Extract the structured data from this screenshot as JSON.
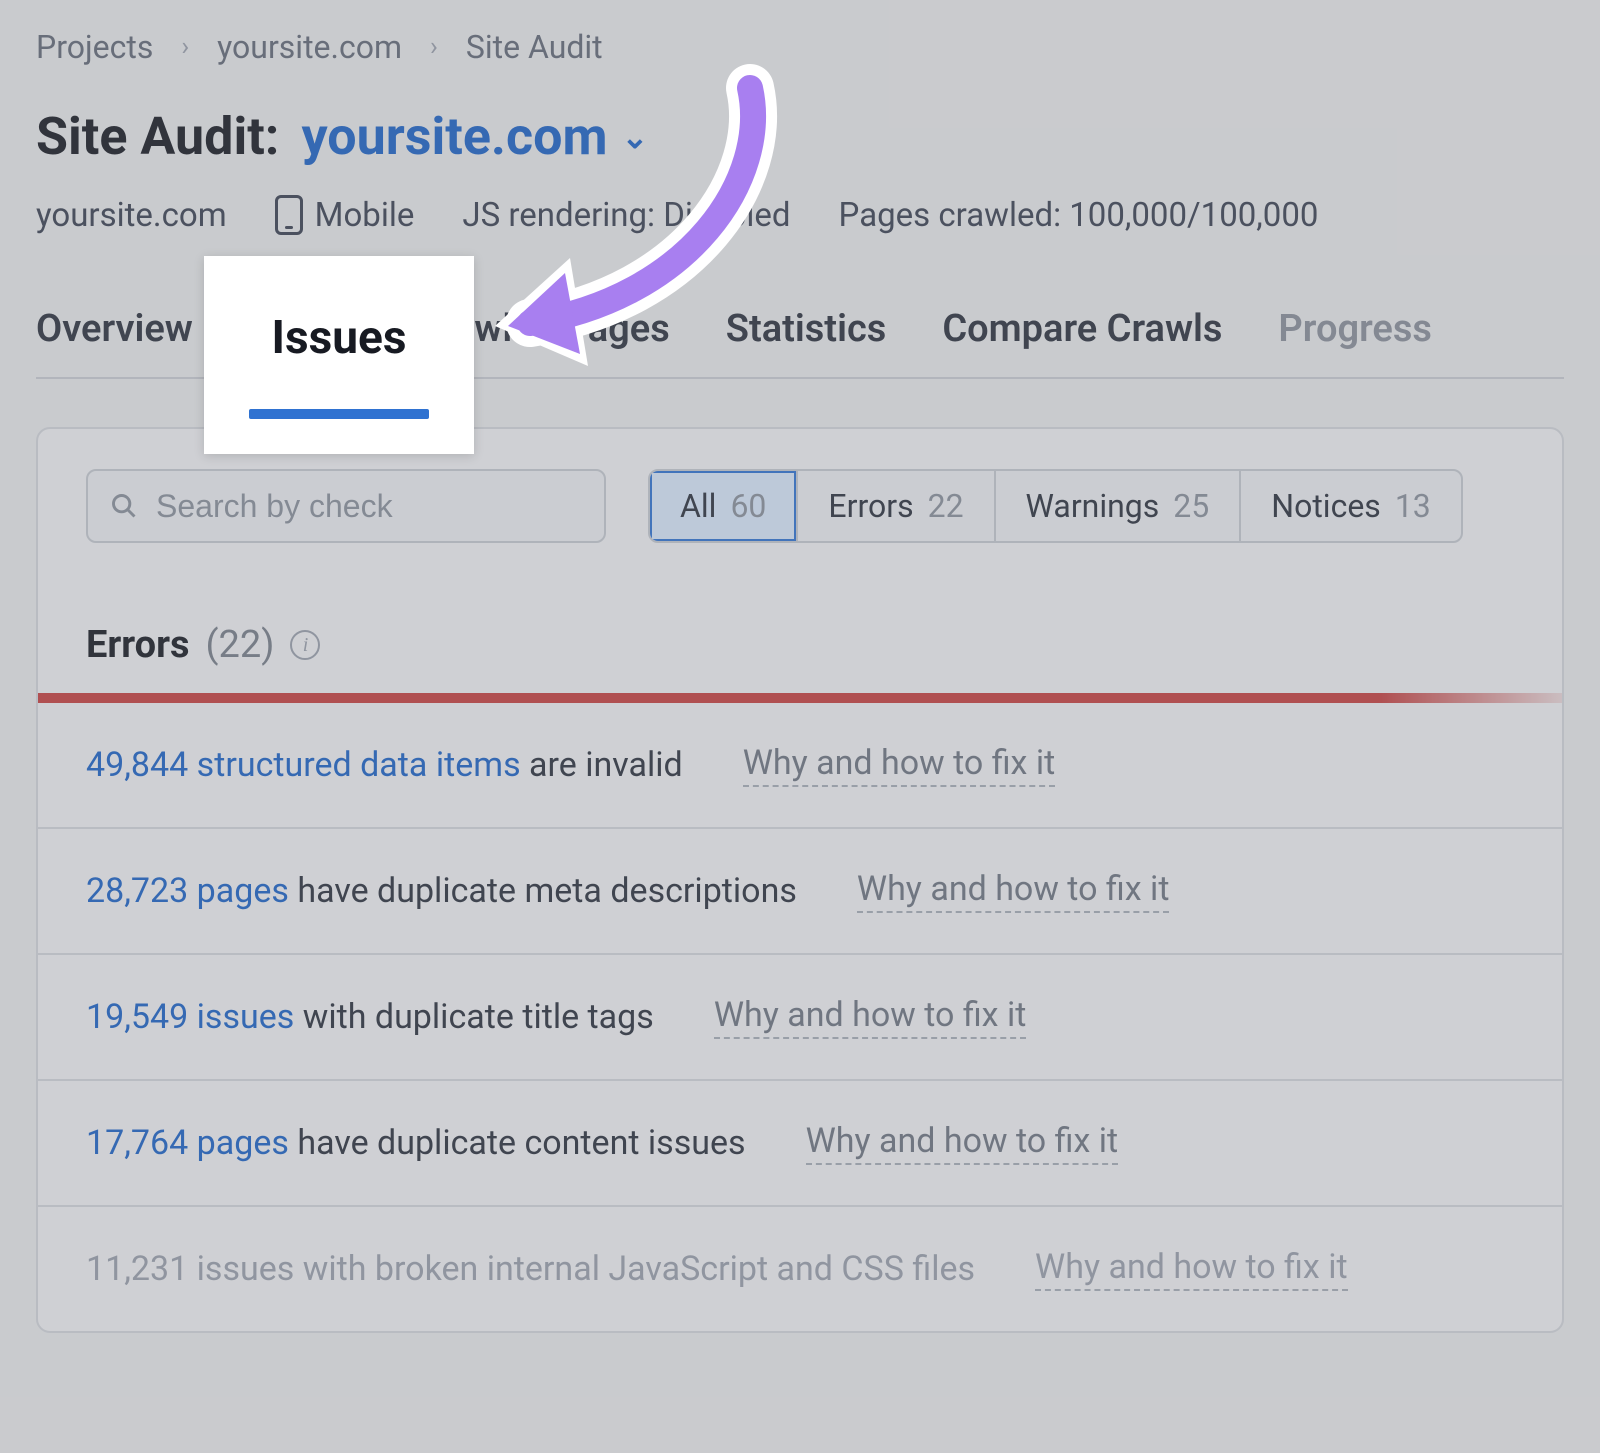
{
  "breadcrumb": {
    "items": [
      "Projects",
      "yoursite.com",
      "Site Audit"
    ]
  },
  "title": {
    "prefix": "Site Audit:",
    "project": "yoursite.com"
  },
  "meta": {
    "domain": "yoursite.com",
    "mobile_label": "Mobile",
    "js_rendering": "JS rendering: Disabled",
    "pages_crawled": "Pages crawled: 100,000/100,000"
  },
  "tabs": {
    "overview": "Overview",
    "issues": "Issues",
    "crawled": "Crawled Pages",
    "statistics": "Statistics",
    "compare": "Compare Crawls",
    "progress": "Progress"
  },
  "highlight": {
    "label": "Issues"
  },
  "search": {
    "placeholder": "Search by check"
  },
  "filters": {
    "all_label": "All",
    "all_count": "60",
    "errors_label": "Errors",
    "errors_count": "22",
    "warnings_label": "Warnings",
    "warnings_count": "25",
    "notices_label": "Notices",
    "notices_count": "13"
  },
  "section": {
    "title": "Errors",
    "count": "(22)"
  },
  "fix_label": "Why and how to fix it",
  "issues": [
    {
      "link": "49,844 structured data items",
      "rest": " are invalid"
    },
    {
      "link": "28,723 pages",
      "rest": " have duplicate meta descriptions"
    },
    {
      "link": "19,549 issues",
      "rest": " with duplicate title tags"
    },
    {
      "link": "17,764 pages",
      "rest": " have duplicate content issues"
    },
    {
      "link": "11,231 issues",
      "rest": " with broken internal JavaScript and CSS files"
    }
  ]
}
